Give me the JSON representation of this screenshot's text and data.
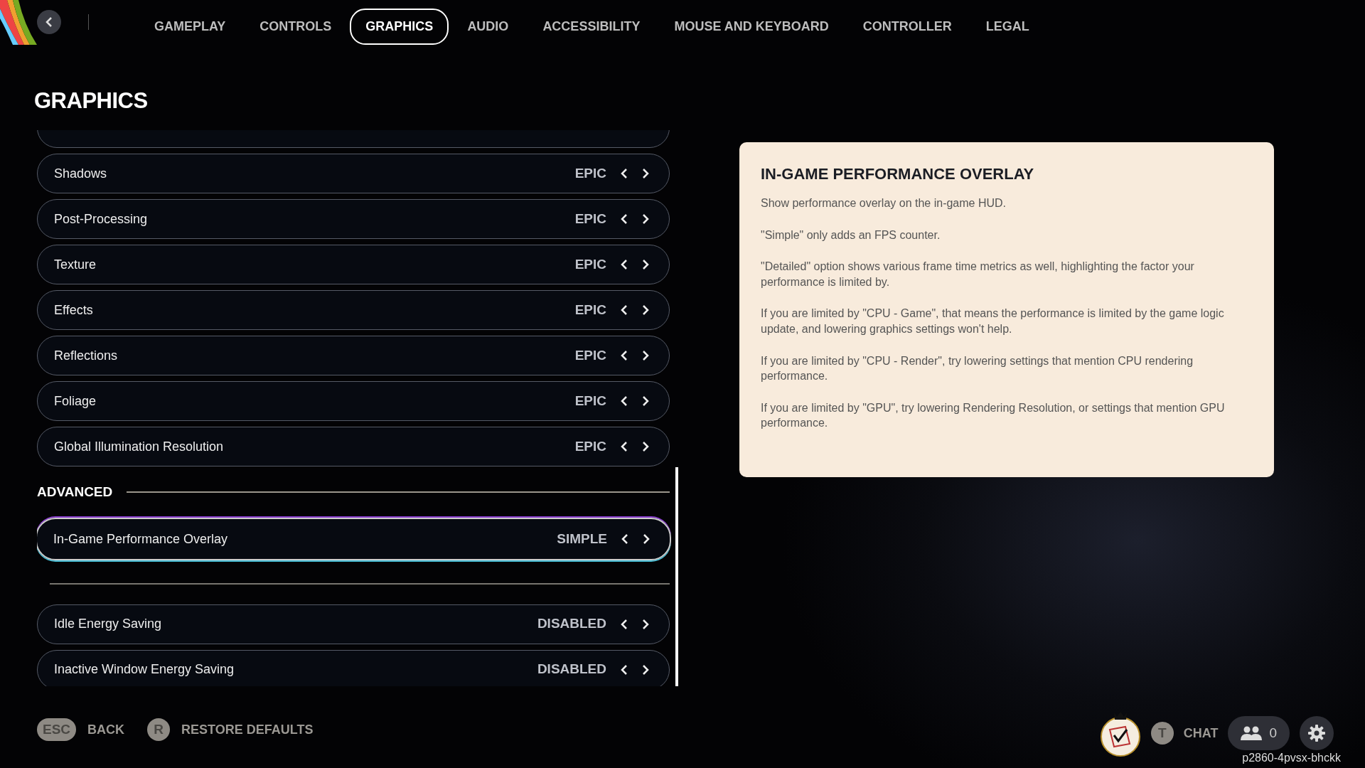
{
  "nav": {
    "tabs": [
      {
        "label": "GAMEPLAY",
        "selected": false
      },
      {
        "label": "CONTROLS",
        "selected": false
      },
      {
        "label": "GRAPHICS",
        "selected": true
      },
      {
        "label": "AUDIO",
        "selected": false
      },
      {
        "label": "ACCESSIBILITY",
        "selected": false
      },
      {
        "label": "MOUSE AND KEYBOARD",
        "selected": false
      },
      {
        "label": "CONTROLLER",
        "selected": false
      },
      {
        "label": "LEGAL",
        "selected": false
      }
    ]
  },
  "page_title": "GRAPHICS",
  "settings": [
    {
      "kind": "clipped"
    },
    {
      "kind": "setting",
      "label": "Shadows",
      "value": "EPIC",
      "selected": false
    },
    {
      "kind": "setting",
      "label": "Post-Processing",
      "value": "EPIC",
      "selected": false
    },
    {
      "kind": "setting",
      "label": "Texture",
      "value": "EPIC",
      "selected": false
    },
    {
      "kind": "setting",
      "label": "Effects",
      "value": "EPIC",
      "selected": false
    },
    {
      "kind": "setting",
      "label": "Reflections",
      "value": "EPIC",
      "selected": false
    },
    {
      "kind": "setting",
      "label": "Foliage",
      "value": "EPIC",
      "selected": false
    },
    {
      "kind": "setting",
      "label": "Global Illumination Resolution",
      "value": "EPIC",
      "selected": false
    },
    {
      "kind": "section",
      "label": "ADVANCED"
    },
    {
      "kind": "setting",
      "label": "In-Game Performance Overlay",
      "value": "SIMPLE",
      "selected": true
    },
    {
      "kind": "divider"
    },
    {
      "kind": "setting",
      "label": "Idle Energy Saving",
      "value": "DISABLED",
      "selected": false
    },
    {
      "kind": "setting",
      "label": "Inactive Window Energy Saving",
      "value": "DISABLED",
      "selected": false
    }
  ],
  "info": {
    "title": "IN-GAME PERFORMANCE OVERLAY",
    "paragraphs": [
      "Show performance overlay on the in-game HUD.",
      "\"Simple\" only adds an FPS counter.",
      "\"Detailed\" option shows various frame time metrics as well, highlighting the factor your performance is limited by.",
      "If you are limited by \"CPU - Game\", that means the performance is limited by the game logic update, and lowering graphics settings won't help.",
      "If you are limited by \"CPU - Render\", try lowering settings that mention CPU rendering performance.",
      "If you are limited by \"GPU\", try lowering Rendering Resolution, or settings that mention GPU performance."
    ]
  },
  "footer": {
    "actions": [
      {
        "key": "ESC",
        "label": "BACK"
      },
      {
        "key": "R",
        "label": "RESTORE DEFAULTS"
      }
    ],
    "chat": {
      "key": "T",
      "label": "CHAT"
    },
    "friends_count": "0",
    "session_code": "p2860-4pvsx-bhckk"
  }
}
